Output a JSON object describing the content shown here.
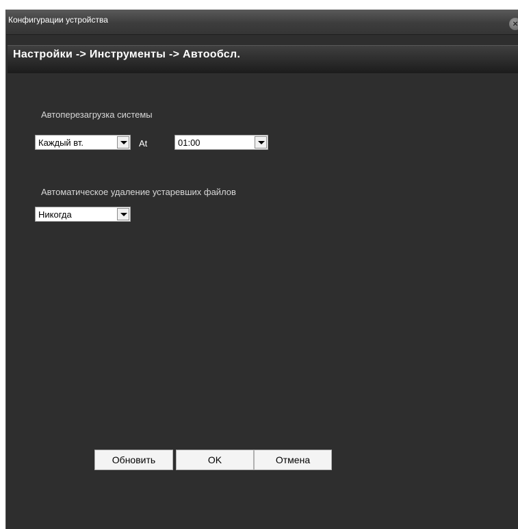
{
  "window": {
    "title": "Конфигурации устройства",
    "close_icon": "close-icon"
  },
  "breadcrumb": "Настройки -> Инструменты -> Автообсл.",
  "reboot": {
    "label": "Автоперезагрузка системы",
    "day_value": "Каждый вт.",
    "at_label": "At",
    "time_value": "01:00"
  },
  "delete_files": {
    "label": "Автоматическое удаление устаревших файлов",
    "value": "Никогда"
  },
  "buttons": {
    "refresh": "Обновить",
    "ok": "OK",
    "cancel": "Отмена"
  }
}
